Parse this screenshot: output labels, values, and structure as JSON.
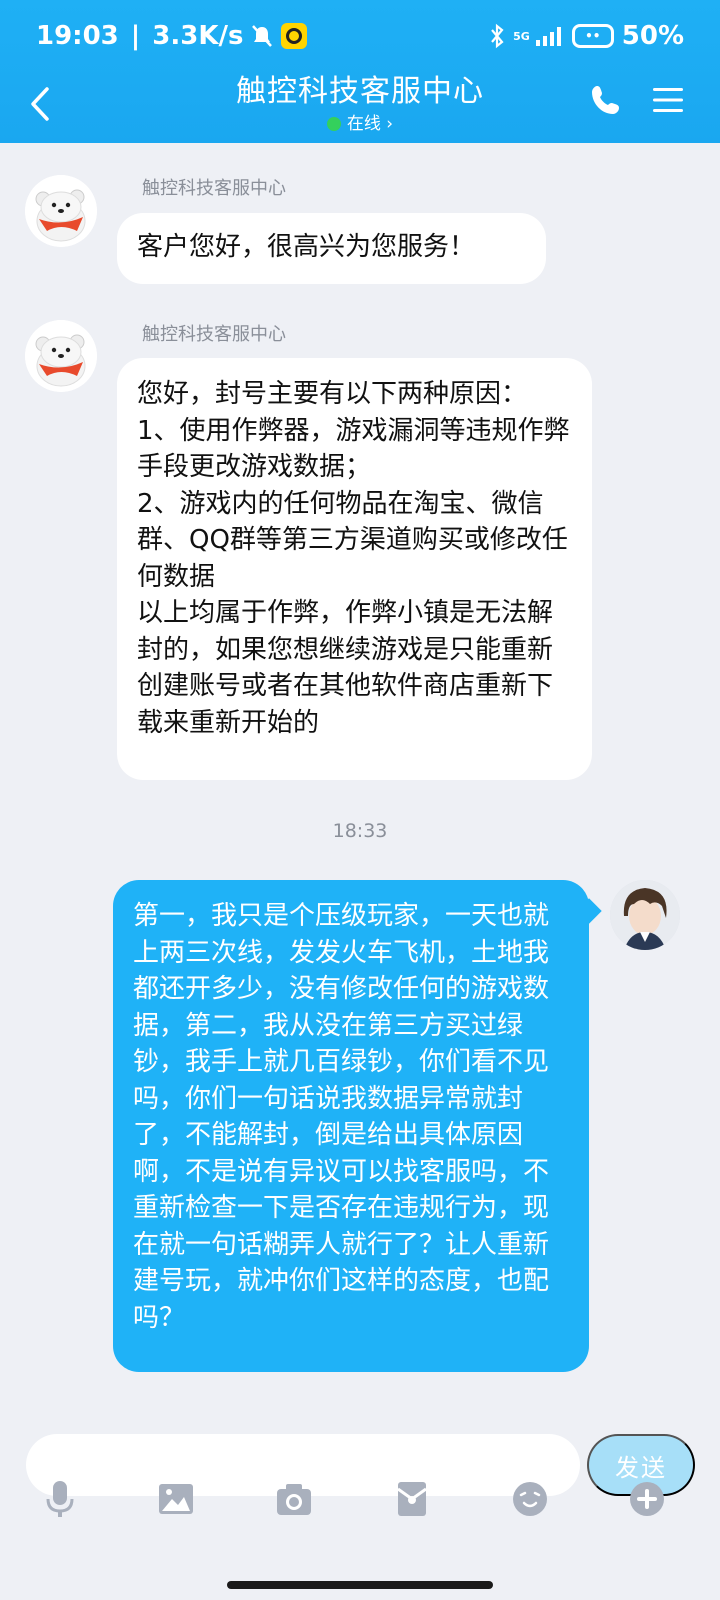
{
  "status_bar": {
    "time": "19:03",
    "speed": "3.3K/s",
    "network": "5G",
    "battery": "50%"
  },
  "header": {
    "title": "触控科技客服中心",
    "status": "在线 ›"
  },
  "messages": [
    {
      "sender": "触控科技客服中心",
      "text": "客户您好，很高兴为您服务！"
    },
    {
      "sender": "触控科技客服中心",
      "text": "您好，封号主要有以下两种原因：\n1、使用作弊器，游戏漏洞等违规作弊手段更改游戏数据；\n2、游戏内的任何物品在淘宝、微信群、QQ群等第三方渠道购买或修改任何数据\n以上均属于作弊，作弊小镇是无法解封的，如果您想继续游戏是只能重新创建账号或者在其他软件商店重新下载来重新开始的"
    }
  ],
  "timestamp": "18:33",
  "outgoing": {
    "text": "第一，我只是个压级玩家，一天也就上两三次线，发发火车飞机，土地我都还开多少，没有修改任何的游戏数据，第二，我从没在第三方买过绿钞，我手上就几百绿钞，你们看不见吗，你们一句话说我数据异常就封了，不能解封，倒是给出具体原因啊，不是说有异议可以找客服吗，不重新检查一下是否存在违规行为，现在就一句话糊弄人就行了？让人重新建号玩，就冲你们这样的态度，也配吗？"
  },
  "input": {
    "placeholder": "",
    "send_label": "发送"
  },
  "toolbar_icons": [
    "microphone-icon",
    "image-icon",
    "camera-icon",
    "red-packet-icon",
    "emoji-icon",
    "plus-icon"
  ],
  "colors": {
    "header": "#1fb0f5",
    "outgoing_bubble": "#1fb2f7",
    "background": "#eef0f5",
    "online_dot": "#34d05c"
  }
}
